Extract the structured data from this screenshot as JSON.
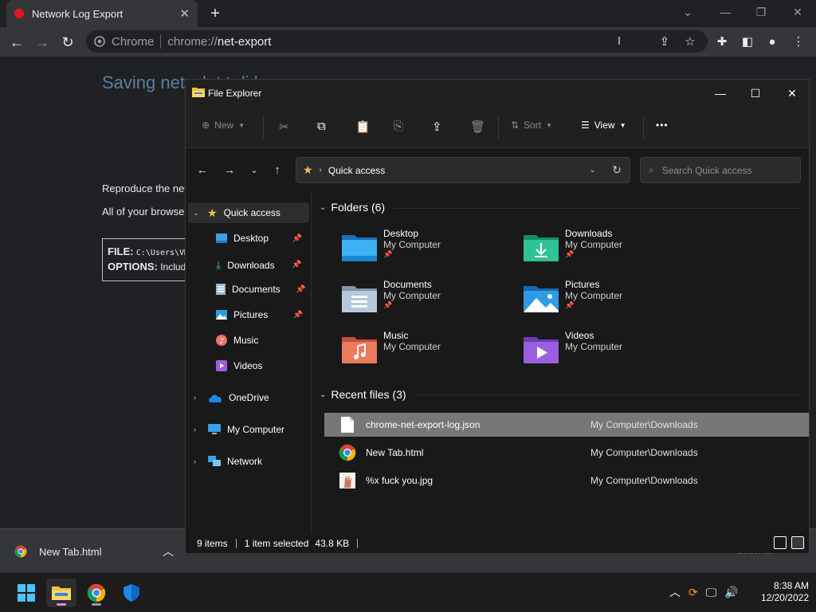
{
  "browser": {
    "tab_title": "Network Log Export",
    "url_site": "Chrome",
    "url_scheme": "chrome://",
    "url_host": "net-export"
  },
  "page": {
    "heading": "Saving netw     k       t t   di  k",
    "para1": "Reproduce the net",
    "para2": "All of your browse",
    "file_label": "FILE:",
    "file_value": "C:\\Users\\VM\\",
    "options_label": "OPTIONS:",
    "options_value": "Includ"
  },
  "shelf": {
    "item": "New Tab.html",
    "show_all": "Show all"
  },
  "taskbar": {
    "time": "8:38 AM",
    "date": "12/20/2022"
  },
  "explorer": {
    "title": "File Explorer",
    "cmdbar": {
      "new": "New",
      "sort": "Sort",
      "view": "View",
      "more": "•••"
    },
    "address": "Quick access",
    "search_placeholder": "Search Quick access",
    "nav": {
      "quick_access": "Quick access",
      "desktop": "Desktop",
      "downloads": "Downloads",
      "documents": "Documents",
      "pictures": "Pictures",
      "music": "Music",
      "videos": "Videos",
      "onedrive": "OneDrive",
      "my_computer": "My Computer",
      "network": "Network"
    },
    "folders_header": "Folders (6)",
    "folders": [
      {
        "name": "Desktop",
        "loc": "My Computer",
        "pinned": true
      },
      {
        "name": "Downloads",
        "loc": "My Computer",
        "pinned": true
      },
      {
        "name": "Documents",
        "loc": "My Computer",
        "pinned": true
      },
      {
        "name": "Pictures",
        "loc": "My Computer",
        "pinned": true
      },
      {
        "name": "Music",
        "loc": "My Computer",
        "pinned": false
      },
      {
        "name": "Videos",
        "loc": "My Computer",
        "pinned": false
      }
    ],
    "recent_header": "Recent files (3)",
    "recent": [
      {
        "name": "chrome-net-export-log.json",
        "loc": "My Computer\\Downloads",
        "selected": true
      },
      {
        "name": "New Tab.html",
        "loc": "My Computer\\Downloads",
        "selected": false
      },
      {
        "name": "%x fuck you.jpg",
        "loc": "My Computer\\Downloads",
        "selected": false
      }
    ],
    "status": {
      "items": "9 items",
      "selected": "1 item selected",
      "size": "43.8 KB"
    }
  },
  "colors": {
    "accent_folder": "#f5c045",
    "selection": "#777777",
    "chrome_bg": "#202124"
  }
}
